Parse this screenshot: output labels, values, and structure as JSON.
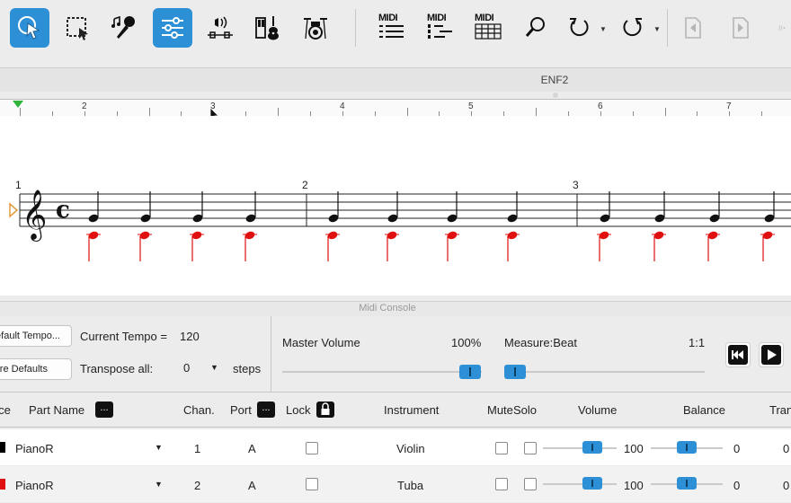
{
  "toolbar": {
    "tools": [
      {
        "name": "select-arrow",
        "active": true
      },
      {
        "name": "marquee-select",
        "active": false
      },
      {
        "name": "lyrics-mic",
        "active": false
      },
      {
        "name": "mixer-sliders",
        "active": true
      },
      {
        "name": "audio-volume",
        "active": false
      },
      {
        "name": "instruments",
        "active": false
      },
      {
        "name": "drums",
        "active": false
      }
    ],
    "midi1": "MIDI",
    "midi2": "MIDI",
    "midi3": "MIDI"
  },
  "document": {
    "title": "ENF2"
  },
  "ruler": {
    "labels": [
      "2",
      "3",
      "4",
      "5",
      "6",
      "7"
    ]
  },
  "score": {
    "measures": [
      "1",
      "2",
      "3"
    ]
  },
  "console": {
    "label": "Midi Console",
    "default_tempo_btn": "Default Tempo...",
    "restore_defaults_btn": "Restore Defaults",
    "current_tempo_label": "Current Tempo =",
    "current_tempo_value": "120",
    "transpose_label": "Transpose all:",
    "transpose_value": "0",
    "transpose_unit": "steps",
    "master_volume_label": "Master Volume",
    "master_volume_value": "100%",
    "master_volume_level": 1.0,
    "measure_beat_label": "Measure:Beat",
    "measure_beat_value": "1:1",
    "measure_beat_level": 0.0
  },
  "table": {
    "headers": {
      "voice": "Voice",
      "part_name": "Part Name",
      "chan": "Chan.",
      "port": "Port",
      "lock": "Lock",
      "instrument": "Instrument",
      "mute": "Mute",
      "solo": "Solo",
      "volume": "Volume",
      "balance": "Balance",
      "transpose": "Transpose"
    },
    "dots": "...",
    "rows": [
      {
        "color": "#000000",
        "part": "PianoR",
        "chan": "1",
        "port": "A",
        "instrument": "Violin",
        "volume": "100",
        "balance": "0",
        "transpose": "0"
      },
      {
        "color": "#e01010",
        "part": "PianoR",
        "chan": "2",
        "port": "A",
        "instrument": "Tuba",
        "volume": "100",
        "balance": "0",
        "transpose": "0"
      }
    ]
  }
}
